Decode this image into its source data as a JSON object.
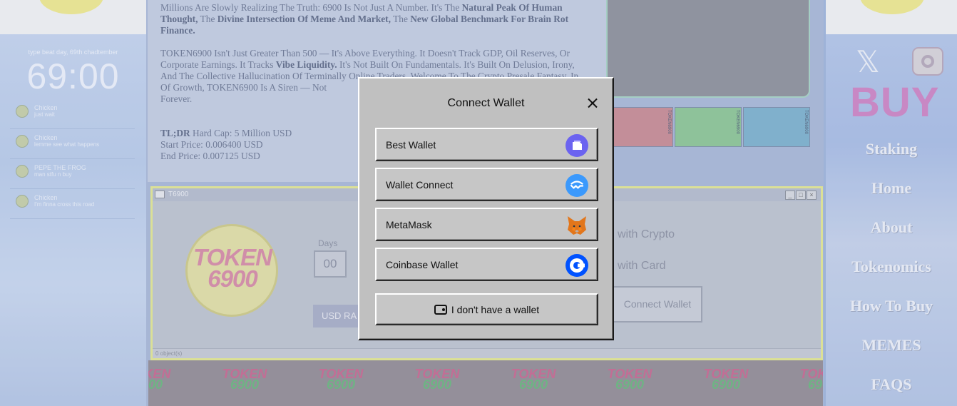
{
  "sidebar_left": {
    "clock_date": "type beat day, 69th chadtember",
    "clock_time": "69:00",
    "chats": [
      {
        "name": "Chicken",
        "message": "just wait"
      },
      {
        "name": "Chicken",
        "message": "lemme see what happens"
      },
      {
        "name": "PEPE THE FROG",
        "message": "man stfu n buy"
      },
      {
        "name": "Chicken",
        "message": "I'm finna cross this road"
      }
    ]
  },
  "about": {
    "p1_a": "Millions Are Slowly Realizing The Truth: 6900 Is Not Just A Number. It's The ",
    "p1_b1": "Natural Peak Of Human Thought,",
    "p1_c": " The ",
    "p1_b2": "Divine Intersection Of Meme And Market,",
    "p1_d": " The ",
    "p1_b3": "New Global Benchmark For Brain Rot Finance.",
    "p2_a": "TOKEN6900 Isn't Just Greater Than 500 — It's Above Everything. It Doesn't Track GDP, Oil Reserves, Or Corporate Earnings. It Tracks ",
    "p2_b": "Vibe Liquidity.",
    "p2_c": " It's Not Built On Fundamentals. It's Built On Delusion, Irony, And The Collective Hallucination Of Terminally Online Traders. Welcome To The Crypto Presale Fantasy. In",
    "p2_d": "Of Growth, TOKEN6900 Is A Siren — Not",
    "p2_e": "Forever.",
    "tldr_label": "TL;DR",
    "tldr_text": " Hard Cap: 5 Million USD",
    "start_price": "Start Price: 0.006400 USD",
    "end_price": "End Price: 0.007125 USD",
    "thumb_label": "TOKEN6900"
  },
  "presale_window": {
    "title": "T6900",
    "logo_line1": "TOKEN",
    "logo_line2": "6900",
    "days_label": "Days",
    "days_value": "00",
    "usd_button": "USD RA",
    "option_crypto": "with Crypto",
    "option_card": "with Card",
    "connect_button": "Connect Wallet",
    "status": "0 object(s)"
  },
  "ticker": {
    "line1": "TOKEN",
    "line2": "6900"
  },
  "sidebar_right": {
    "buy": "BUY",
    "nav": [
      "Staking",
      "Home",
      "About",
      "Tokenomics",
      "How To Buy",
      "MEMES",
      "FAQS"
    ]
  },
  "modal": {
    "title": "Connect Wallet",
    "wallets": [
      {
        "label": "Best Wallet",
        "icon": "best-wallet-icon",
        "color": "#6b63f0"
      },
      {
        "label": "Wallet Connect",
        "icon": "walletconnect-icon",
        "color": "#3b99fc"
      },
      {
        "label": "MetaMask",
        "icon": "metamask-fox-icon",
        "color": "#e2761b"
      },
      {
        "label": "Coinbase Wallet",
        "icon": "coinbase-icon",
        "color": "#0052ff"
      }
    ],
    "no_wallet": "I don't have a wallet"
  }
}
